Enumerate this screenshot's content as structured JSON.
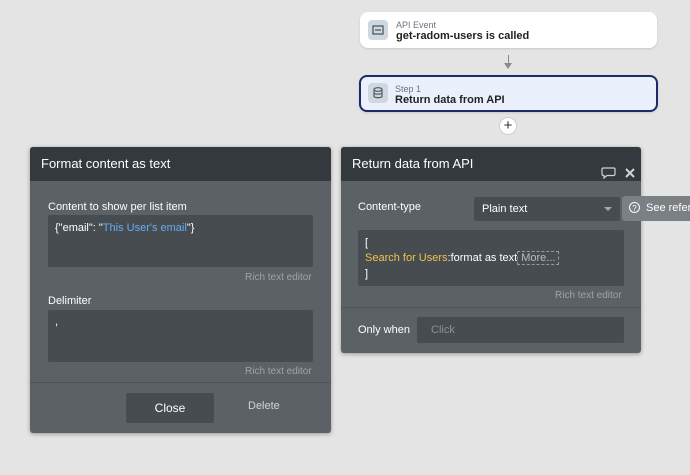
{
  "workflow": {
    "event": {
      "sub": "API Event",
      "title": "get-radom-users is called"
    },
    "step": {
      "sub": "Step 1",
      "title": "Return data from API"
    }
  },
  "format_panel": {
    "title": "Format content as text",
    "content_label": "Content to show per list item",
    "content_prefix": "{\"email\": \"",
    "content_dynamic": "This User's email",
    "content_suffix": "\"}",
    "rich_hint_1": "Rich text editor",
    "delimiter_label": "Delimiter",
    "delimiter_value": ",",
    "rich_hint_2": "Rich text editor",
    "close_label": "Close",
    "delete_label": "Delete"
  },
  "return_panel": {
    "title": "Return data from API",
    "content_type_label": "Content-type",
    "content_type_value": "Plain text",
    "line1": "[",
    "expr_dynamic": "Search for Users",
    "expr_text": ":format as text",
    "more_label": "More...",
    "line3": "]",
    "rich_hint": "Rich text editor",
    "only_when_label": "Only when",
    "only_when_placeholder": "Click"
  },
  "reference_button": "See refer"
}
